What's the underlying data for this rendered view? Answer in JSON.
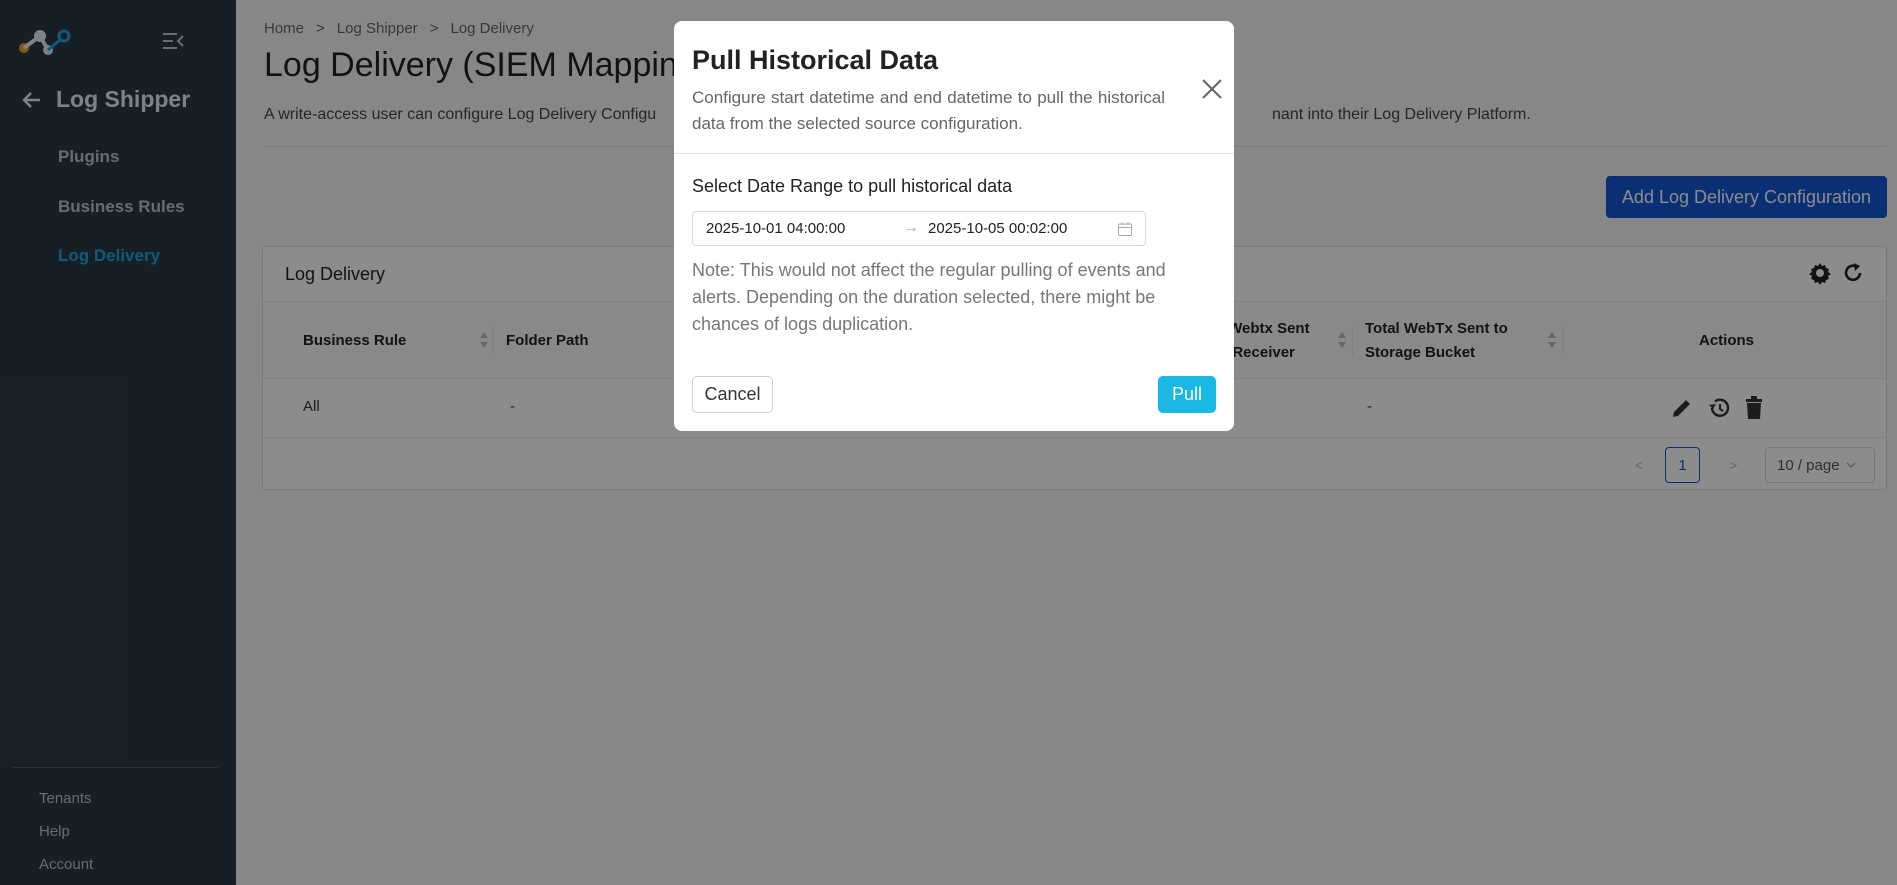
{
  "sidebar": {
    "back_title": "Log Shipper",
    "items": [
      {
        "label": "Plugins",
        "active": false
      },
      {
        "label": "Business Rules",
        "active": false
      },
      {
        "label": "Log Delivery",
        "active": true
      }
    ],
    "footer": [
      "Tenants",
      "Help",
      "Account"
    ]
  },
  "breadcrumb": [
    "Home",
    ">",
    "Log Shipper",
    ">",
    "Log Delivery"
  ],
  "page": {
    "title": "Log Delivery (SIEM Mapping",
    "description_left": "A write-access user can configure Log Delivery Configu",
    "description_right": "nant into their Log Delivery Platform.",
    "add_button": "Add Log Delivery Configuration"
  },
  "table": {
    "card_title": "Log Delivery",
    "columns": [
      "Business Rule",
      "Folder Path",
      "/Webtx Sent",
      "l Receiver",
      "Total WebTx Sent to",
      "Storage Bucket",
      "Actions"
    ],
    "rows": [
      {
        "business_rule": "All",
        "folder_path": "-",
        "webtx_storage": "-"
      }
    ],
    "pagination": {
      "prev": "<",
      "page": "1",
      "next": ">",
      "page_size": "10 / page"
    }
  },
  "modal": {
    "title": "Pull Historical Data",
    "subtitle": "Configure start datetime and end datetime to pull the historical data from the selected source configuration.",
    "range_label": "Select Date Range to pull historical data",
    "start": "2025-10-01 04:00:00",
    "arrow": "→",
    "end": "2025-10-05 00:02:00",
    "note": "Note: This would not affect the regular pulling of events and alerts. Depending on the duration selected, there might be chances of logs duplication.",
    "cancel": "Cancel",
    "pull": "Pull"
  },
  "colors": {
    "sidebar": "#283a46",
    "accent": "#1ea7dc",
    "primary": "#1457d6",
    "pull": "#1ab8e4"
  }
}
